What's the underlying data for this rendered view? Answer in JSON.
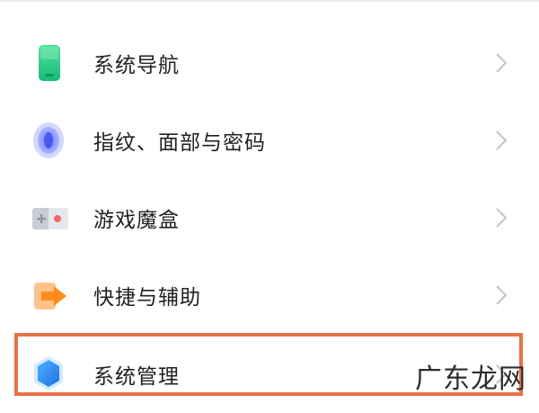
{
  "settings": {
    "items": [
      {
        "label": "系统导航",
        "icon": "phone-navigation-icon"
      },
      {
        "label": "指纹、面部与密码",
        "icon": "fingerprint-icon"
      },
      {
        "label": "游戏魔盒",
        "icon": "game-box-icon"
      },
      {
        "label": "快捷与辅助",
        "icon": "shortcut-arrow-icon"
      },
      {
        "label": "系统管理",
        "icon": "system-hexagon-icon"
      }
    ]
  },
  "highlight": {
    "color": "#e9714a"
  },
  "watermark": {
    "text": "广东龙网"
  }
}
